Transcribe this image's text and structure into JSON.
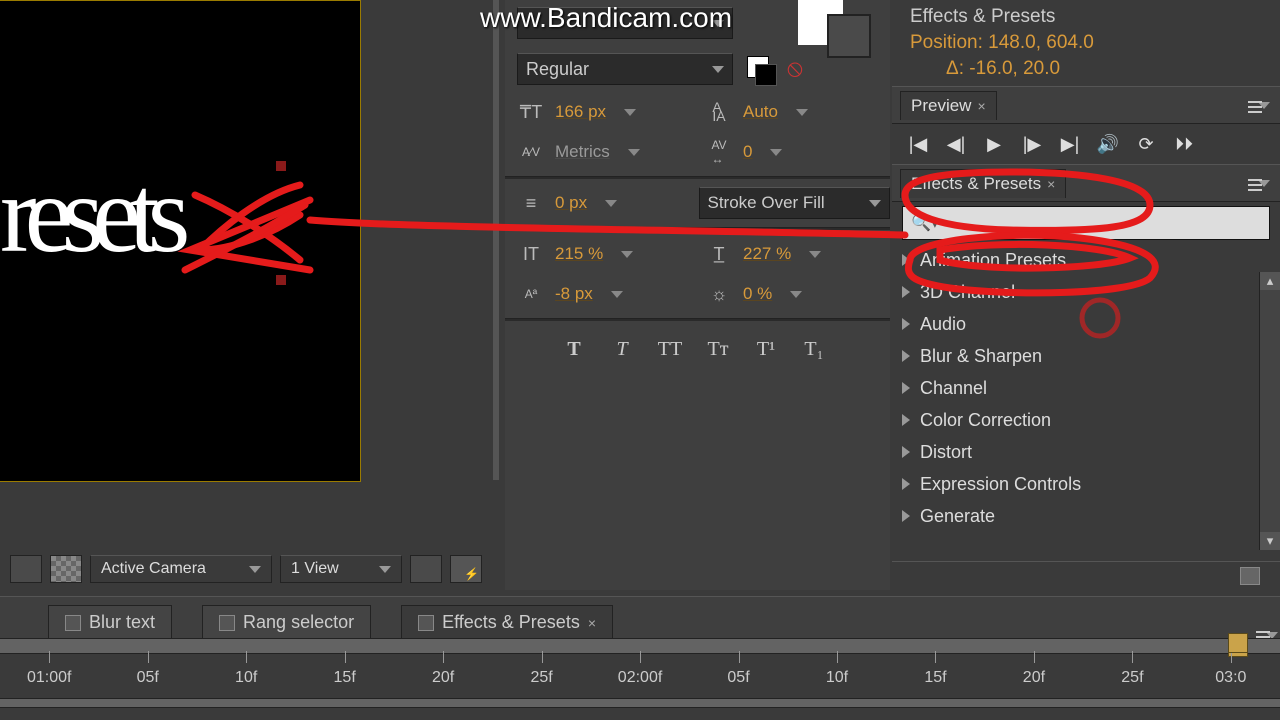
{
  "watermark": "www.Bandicam.com",
  "viewport": {
    "text_partial": "resets"
  },
  "info_panel": {
    "title": "Effects & Presets",
    "position_label": "Position: 148.0, 604.0",
    "delta_label": "Δ: -16.0, 20.0"
  },
  "character": {
    "font_style": "Regular",
    "font_size": "166 px",
    "leading": "Auto",
    "kerning": "Metrics",
    "tracking": "0",
    "stroke_width": "0 px",
    "stroke_order": "Stroke Over Fill",
    "vert_scale": "215 %",
    "horiz_scale": "227 %",
    "baseline_shift": "-8 px",
    "tsume": "0 %",
    "styles": {
      "bold": "T",
      "italic": "T",
      "allcaps": "TT",
      "smallcaps": "Tᴛ",
      "superscript": "T¹",
      "subscript": "T₁"
    }
  },
  "preview_panel": {
    "title": "Preview"
  },
  "effects_panel": {
    "title": "Effects & Presets",
    "search_placeholder": "",
    "categories": [
      "Animation Presets",
      "3D Channel",
      "Audio",
      "Blur & Sharpen",
      "Channel",
      "Color Correction",
      "Distort",
      "Expression Controls",
      "Generate"
    ]
  },
  "viewer_bar": {
    "camera": "Active Camera",
    "views": "1 View"
  },
  "project_tabs": [
    {
      "label": "Blur text"
    },
    {
      "label": "Rang selector"
    },
    {
      "label": "Effects & Presets"
    }
  ],
  "timeline_ticks": [
    "01:00f",
    "05f",
    "10f",
    "15f",
    "20f",
    "25f",
    "02:00f",
    "05f",
    "10f",
    "15f",
    "20f",
    "25f",
    "03:0"
  ]
}
